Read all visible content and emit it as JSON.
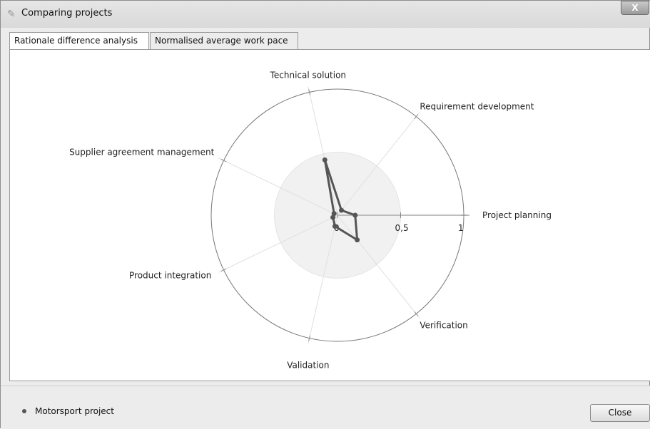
{
  "window": {
    "title": "Comparing projects",
    "close_glyph": "X",
    "icon": "pen-icon"
  },
  "tabs": [
    {
      "label": "Rationale difference analysis",
      "active": true
    },
    {
      "label": "Normalised average work pace",
      "active": false
    }
  ],
  "chart_data": {
    "type": "radar",
    "axes": [
      "Project planning",
      "Requirement development",
      "Technical solution",
      "Supplier agreement management",
      "Product integration",
      "Validation",
      "Verification"
    ],
    "radial_ticks": [
      "0",
      "0,5",
      "1"
    ],
    "rlim": [
      0,
      1
    ],
    "inner_band_max": 0.5,
    "series": [
      {
        "name": "Motorsport project",
        "color": "#555555",
        "values": [
          0.14,
          0.05,
          0.45,
          0.03,
          0.04,
          0.09,
          0.25
        ]
      }
    ]
  },
  "legend": {
    "label": "Motorsport project"
  },
  "buttons": {
    "close_label": "Close"
  }
}
